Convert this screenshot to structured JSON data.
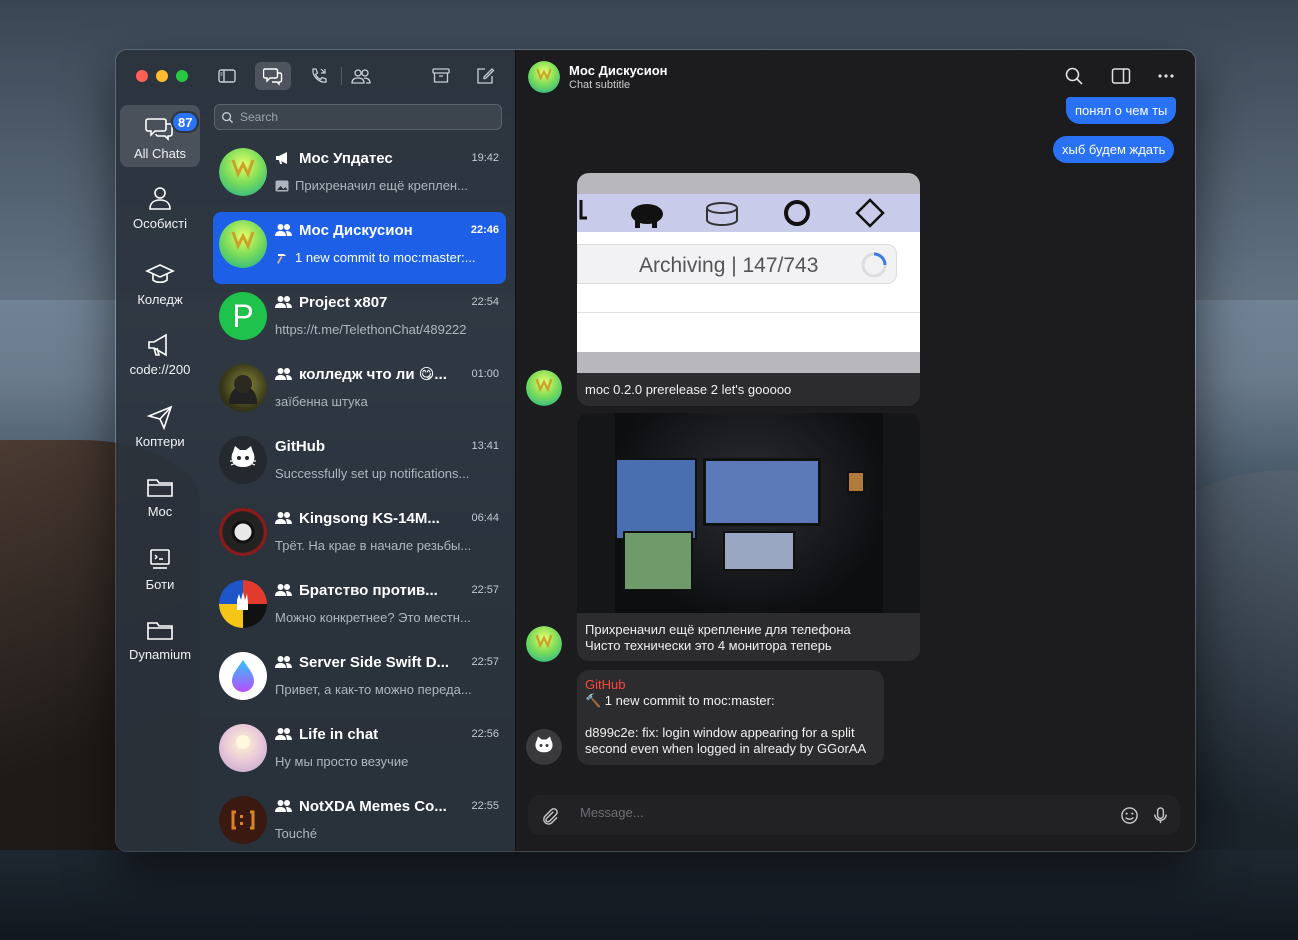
{
  "window": {
    "traffic_lights": [
      "close",
      "minimize",
      "zoom"
    ],
    "toolbar_icons": [
      "sidebar-icon",
      "chats-icon",
      "calls-icon",
      "contacts-icon",
      "archive-icon",
      "compose-icon"
    ]
  },
  "folders": [
    {
      "label": "All Chats",
      "icon": "chat-bubbles-icon",
      "badge": "87",
      "active": true
    },
    {
      "label": "Особисті",
      "icon": "person-icon"
    },
    {
      "label": "Коледж",
      "icon": "graduation-cap-icon"
    },
    {
      "label": "code://200",
      "icon": "megaphone-icon"
    },
    {
      "label": "Коптери",
      "icon": "paper-plane-icon"
    },
    {
      "label": "Moc",
      "icon": "folder-icon"
    },
    {
      "label": "Боти",
      "icon": "computer-icon"
    },
    {
      "label": "Dynamium",
      "icon": "folder-icon"
    }
  ],
  "search": {
    "placeholder": "Search"
  },
  "chats": [
    {
      "name": "Moc Упдатес",
      "time": "19:42",
      "preview": "Прихреначил ещё креплен...",
      "kind": "channel",
      "preview_icon": "photo-icon"
    },
    {
      "name": "Moc Дискусион",
      "time": "22:46",
      "preview": "1 new commit to moc:master:...",
      "kind": "group",
      "preview_icon": "hammer-icon",
      "selected": true
    },
    {
      "name": "Project x807",
      "time": "22:54",
      "preview": "https://t.me/TelethonChat/489222",
      "kind": "group",
      "avatar_letter": "P"
    },
    {
      "name": "колледж что ли 😋...",
      "time": "01:00",
      "preview": "заїбенна штука",
      "kind": "group"
    },
    {
      "name": "GitHub",
      "time": "13:41",
      "preview": "Successfully set up notifications...",
      "kind": "user"
    },
    {
      "name": "Kingsong KS-14M...",
      "time": "06:44",
      "preview": "Трёт. На крае в начале резьбы...",
      "kind": "group"
    },
    {
      "name": "Братство против...",
      "time": "22:57",
      "preview": "Можно конкретнее? Это местн...",
      "kind": "group"
    },
    {
      "name": "Server Side Swift D...",
      "time": "22:57",
      "preview": "Привет, а как-то можно переда...",
      "kind": "group"
    },
    {
      "name": "Life in chat",
      "time": "22:56",
      "preview": "Ну мы просто везучие",
      "kind": "group"
    },
    {
      "name": "NotXDA Memes Co...",
      "time": "22:55",
      "preview": "Touché",
      "kind": "group"
    }
  ],
  "conversation": {
    "title": "Moc Дискусион",
    "subtitle": "Chat subtitle",
    "outgoing": [
      "понял о чем ты",
      "хыб будем ждать"
    ],
    "screenshot_text": "Archiving | 147/743",
    "messages": [
      {
        "text": "moc 0.2.0 prerelease 2 let's gooooo"
      },
      {
        "lines": [
          "Прихреначил ещё крепление для телефона",
          "Чисто технически это 4 монитора теперь"
        ]
      },
      {
        "sender": "GitHub",
        "lines": [
          "🔨 1 new commit to moc:master:",
          "",
          "d899c2e: fix: login window appearing for a split",
          "second even when logged in already by GGorAA"
        ]
      }
    ]
  },
  "composer": {
    "placeholder": "Message..."
  },
  "colors": {
    "accent": "#2a72f5",
    "selected_row": "#1d5fe6",
    "badge": "#2a73f5",
    "sender_github": "#ff453a"
  }
}
